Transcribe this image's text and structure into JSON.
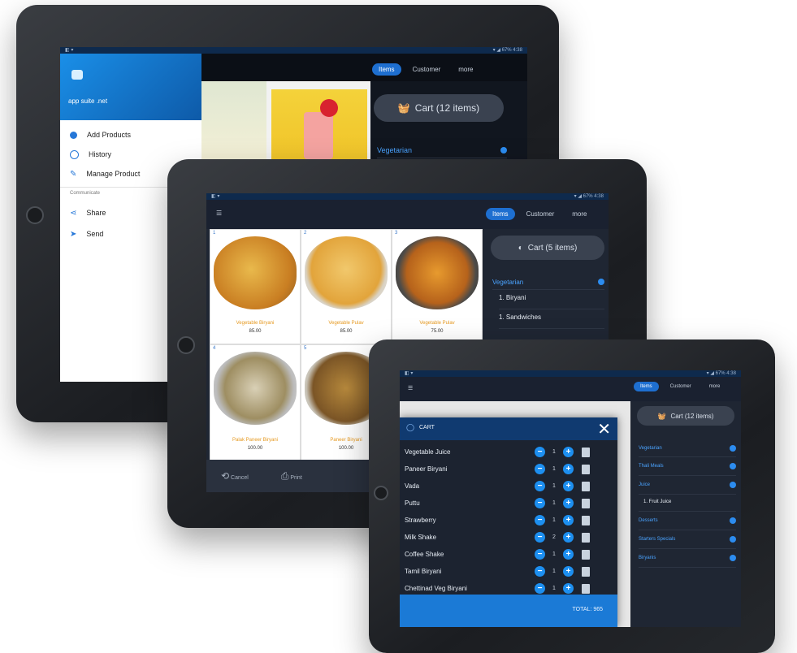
{
  "tablet1": {
    "drawer": {
      "app_name": "app suite .net",
      "items": [
        {
          "label": "Add Products",
          "icon": "add-icon"
        },
        {
          "label": "History",
          "icon": "history-icon"
        },
        {
          "label": "Manage Product",
          "icon": "manage-icon"
        }
      ],
      "section_label": "Communicate",
      "comm_items": [
        {
          "label": "Share",
          "icon": "share-icon"
        },
        {
          "label": "Send",
          "icon": "send-icon"
        }
      ]
    },
    "tabs": [
      "Items",
      "Customer",
      "more"
    ],
    "cart_label": "Cart (12 items)",
    "category": "Vegetarian"
  },
  "tablet2": {
    "tabs": [
      "Items",
      "Customer",
      "more"
    ],
    "cart_label": "Cart (5 items)",
    "category": "Vegetarian",
    "subitems": [
      "1. Biryani",
      "1. Sandwiches"
    ],
    "foods": [
      {
        "num": "1",
        "name": "Vegetable Biryani",
        "price": "85.00"
      },
      {
        "num": "2",
        "name": "Vegetable Pulav",
        "price": "85.00"
      },
      {
        "num": "3",
        "name": "Vegetable Pulav",
        "price": "75.00"
      },
      {
        "num": "4",
        "name": "Palak Paneer Biryani",
        "price": "100.00"
      },
      {
        "num": "5",
        "name": "Paneer Biryani",
        "price": "100.00"
      }
    ],
    "bottom": {
      "cancel": "Cancel",
      "print": "Print"
    }
  },
  "tablet3": {
    "tabs": [
      "Items",
      "Customer",
      "more"
    ],
    "cart_label": "Cart (12 items)",
    "cart_title": "CART",
    "categories": [
      "Vegetarian",
      "Thali Meals",
      "Juice",
      "Desserts",
      "Starters Specials",
      "Biryanis"
    ],
    "juice_sub": "1. Fruit Juice",
    "cart_items": [
      {
        "name": "Vegetable Juice",
        "qty": "1"
      },
      {
        "name": "Paneer Biryani",
        "qty": "1"
      },
      {
        "name": "Vada",
        "qty": "1"
      },
      {
        "name": "Puttu",
        "qty": "1"
      },
      {
        "name": "Strawberry",
        "qty": "1"
      },
      {
        "name": "Milk Shake",
        "qty": "2"
      },
      {
        "name": "Coffee Shake",
        "qty": "1"
      },
      {
        "name": "Tamil Biryani",
        "qty": "1"
      },
      {
        "name": "Chettinad Veg Biryani",
        "qty": "1"
      }
    ],
    "total_label": "TOTAL: 965"
  }
}
